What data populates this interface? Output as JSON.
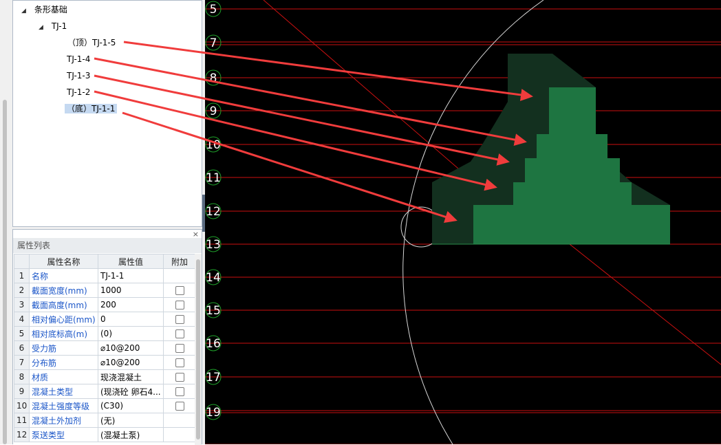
{
  "tree": {
    "root_label": "条形基础",
    "group_label": "TJ-1",
    "layers": [
      {
        "label": "（顶）TJ-1-5",
        "selected": false
      },
      {
        "label": "TJ-1-4",
        "selected": false
      },
      {
        "label": "TJ-1-3",
        "selected": false
      },
      {
        "label": "TJ-1-2",
        "selected": false
      },
      {
        "label": "（底）TJ-1-1",
        "selected": true
      }
    ]
  },
  "properties": {
    "title": "属性列表",
    "close_glyph": "×",
    "columns": [
      "",
      "属性名称",
      "属性值",
      "附加"
    ],
    "rows": [
      {
        "num": "1",
        "name": "名称",
        "value": "TJ-1-1",
        "checkbox": false
      },
      {
        "num": "2",
        "name": "截面宽度(mm)",
        "value": "1000",
        "checkbox": true
      },
      {
        "num": "3",
        "name": "截面高度(mm)",
        "value": "200",
        "checkbox": true
      },
      {
        "num": "4",
        "name": "相对偏心距(mm)",
        "value": "0",
        "checkbox": true
      },
      {
        "num": "5",
        "name": "相对底标高(m)",
        "value": "(0)",
        "checkbox": true
      },
      {
        "num": "6",
        "name": "受力筋",
        "value": "⌀10@200",
        "checkbox": true
      },
      {
        "num": "7",
        "name": "分布筋",
        "value": "⌀10@200",
        "checkbox": true
      },
      {
        "num": "8",
        "name": "材质",
        "value": "现浇混凝土",
        "checkbox": true
      },
      {
        "num": "9",
        "name": "混凝土类型",
        "value": "(现浇砼 卵石4...",
        "checkbox": true
      },
      {
        "num": "10",
        "name": "混凝土强度等级",
        "value": "(C30)",
        "checkbox": true
      },
      {
        "num": "11",
        "name": "混凝土外加剂",
        "value": "(无)",
        "checkbox": false
      },
      {
        "num": "12",
        "name": "泵送类型",
        "value": "(混凝土泵)",
        "checkbox": false
      }
    ]
  },
  "canvas": {
    "background": "#000000",
    "grid_line_color": "#cc1111",
    "axis_label_color": "#ffffff",
    "axis_bubble_color": "#1fa32b",
    "axis_labels": [
      "5",
      "7",
      "8",
      "9",
      "10",
      "11",
      "12",
      "13",
      "14",
      "15",
      "16",
      "17",
      "19"
    ],
    "dark_fill": "#13301f",
    "bright_fill": "#1e7541",
    "arrow_color": "#f03c3c"
  }
}
